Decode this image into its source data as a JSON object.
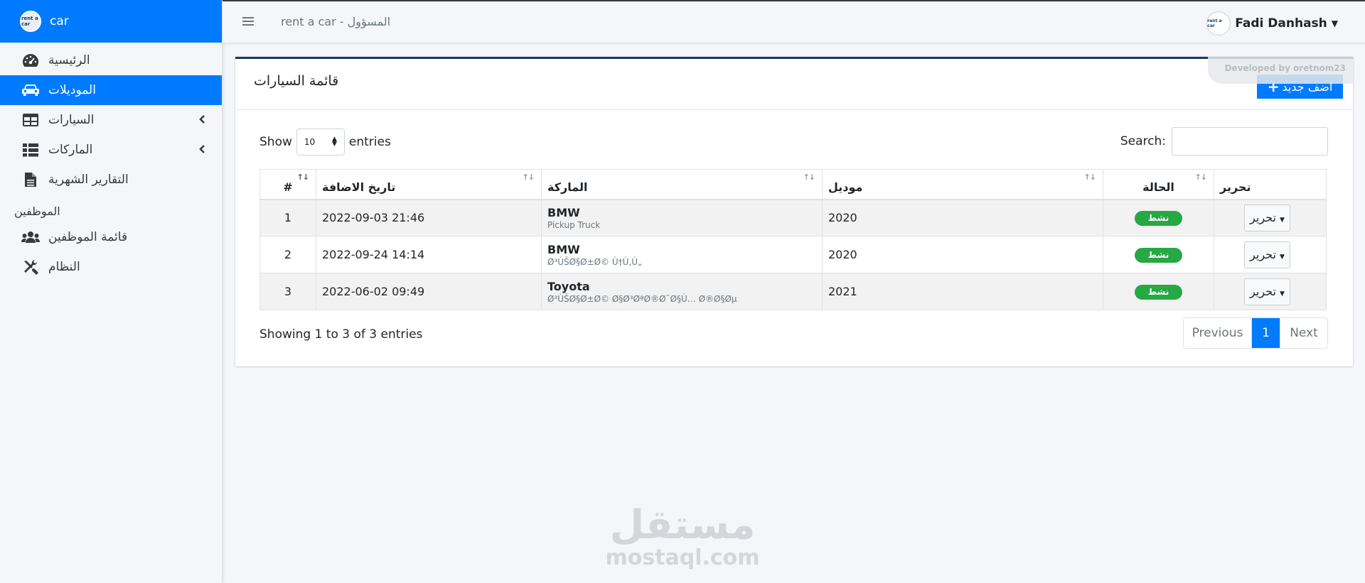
{
  "sidebar": {
    "brand_logo": "rent a car",
    "brand_text": "car",
    "items": [
      {
        "label": "الرئيسية",
        "icon": "dashboard-icon"
      },
      {
        "label": "الموديلات",
        "icon": "car-icon",
        "active": true
      },
      {
        "label": "السيارات",
        "icon": "table-icon"
      },
      {
        "label": "الماركات",
        "icon": "list-icon"
      },
      {
        "label": "التقارير الشهرية",
        "icon": "file-icon"
      }
    ],
    "section_header": "الموظفين",
    "items2": [
      {
        "label": "قائمة الموظفين",
        "icon": "users-icon"
      },
      {
        "label": "النظام",
        "icon": "tools-icon"
      }
    ]
  },
  "header": {
    "title": "rent a car - المسؤول",
    "user_name": "Fadi Danhash",
    "avatar_text": "rent a car"
  },
  "card": {
    "title": "قائمة السيارات",
    "add_label": "اضف جديد",
    "dev_badge": "Developed by oretnom23"
  },
  "controls": {
    "show_label": "Show",
    "entries_value": "10",
    "entries_label": "entries",
    "search_label": "Search:"
  },
  "table": {
    "headers": [
      "#",
      "تاريخ الاضافة",
      "الماركة",
      "موديل",
      "الحالة",
      "تحرير"
    ],
    "rows": [
      {
        "num": "1",
        "date": "2022-09-03 21:46",
        "brand": "BMW",
        "sub": "Pickup Truck",
        "model": "2020",
        "status": "نشط",
        "action": "تحرير"
      },
      {
        "num": "2",
        "date": "2022-09-24 14:14",
        "brand": "BMW",
        "sub": "Ø³ÙŠØ§Ø±Ø© Ù†Ù‚Ù„",
        "model": "2020",
        "status": "نشط",
        "action": "تحرير"
      },
      {
        "num": "3",
        "date": "2022-06-02 09:49",
        "brand": "Toyota",
        "sub": "Ø³ÙŠØ§Ø±Ø© Ø§Ø³ØªØ®Ø¯Ø§Ù… Ø®Ø§Øµ",
        "model": "2021",
        "status": "نشط",
        "action": "تحرير"
      }
    ]
  },
  "footer": {
    "info": "Showing 1 to 3 of 3 entries",
    "prev": "Previous",
    "page": "1",
    "next": "Next"
  },
  "watermark": {
    "arabic": "مستقل",
    "latin": "mostaql.com"
  },
  "colors": {
    "primary": "#007bff",
    "success": "#28a745",
    "card_top": "#1d3a5f"
  }
}
